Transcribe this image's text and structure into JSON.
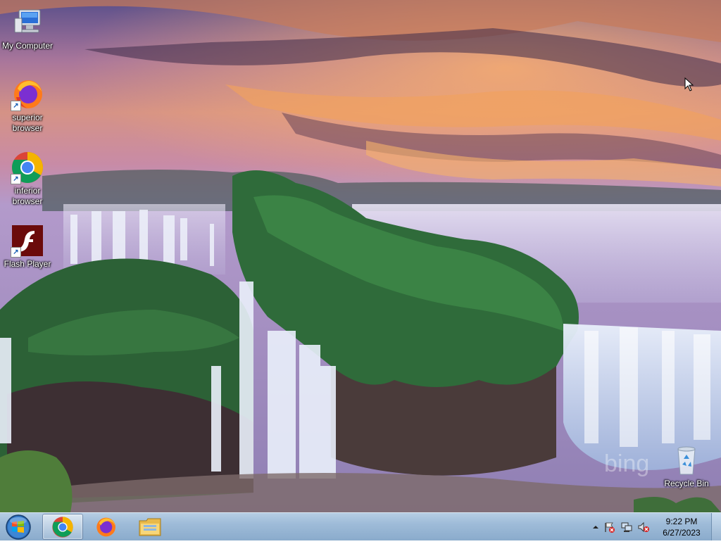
{
  "desktop": {
    "icons": [
      {
        "label": "My Computer",
        "icon": "computer-icon"
      },
      {
        "label": "superior browser",
        "icon": "firefox-icon"
      },
      {
        "label": "inferior browser",
        "icon": "chrome-icon"
      },
      {
        "label": "Flash Player",
        "icon": "flash-icon"
      },
      {
        "label": "Recycle Bin",
        "icon": "recycle-bin-icon"
      }
    ],
    "wallpaper_watermark": "bing"
  },
  "taskbar": {
    "start": "start-orb-icon",
    "pinned": [
      {
        "icon": "chrome-icon",
        "active": true
      },
      {
        "icon": "firefox-icon",
        "active": false
      },
      {
        "icon": "folder-icon",
        "active": false
      }
    ],
    "tray": {
      "icons": [
        "tray-expand-icon",
        "action-center-warning-icon",
        "network-icon",
        "volume-muted-icon"
      ],
      "time": "9:22 PM",
      "date": "6/27/2023"
    }
  },
  "colors": {
    "taskbar_top": "#b5cde4",
    "taskbar_bottom": "#8aabcc",
    "sky_orange": "#f08a4b",
    "sky_purple": "#7a5a9a",
    "forest_green": "#2f6b3a"
  }
}
